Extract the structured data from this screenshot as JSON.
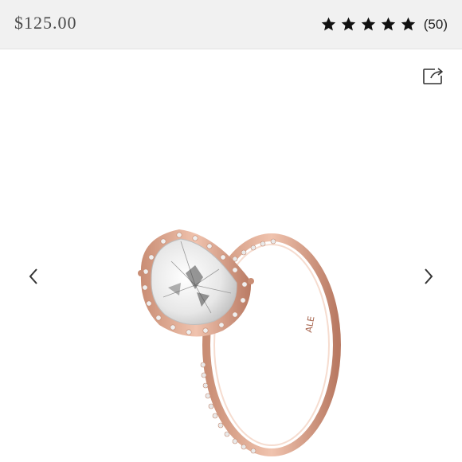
{
  "header": {
    "price": "$125.00",
    "rating": 5,
    "review_count": "(50)"
  },
  "icons": {
    "star": "star-icon",
    "share": "share-icon",
    "prev": "chevron-left-icon",
    "next": "chevron-right-icon"
  },
  "product_image": {
    "engraving": "ALE"
  },
  "colors": {
    "header_bg": "#f1f1f1",
    "rose_gold": "#d9a087",
    "star": "#111111"
  }
}
